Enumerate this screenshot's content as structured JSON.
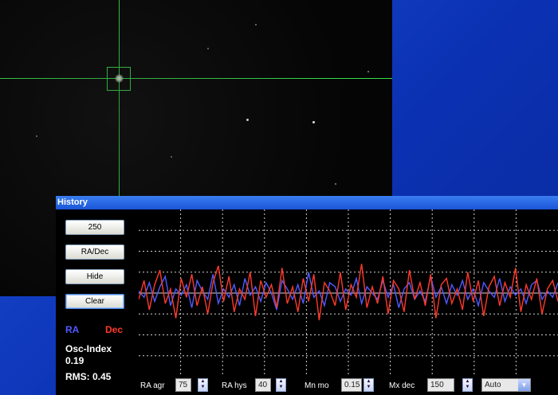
{
  "history_window": {
    "title": "History",
    "buttons": {
      "scale": "250",
      "mode": "RA/Dec",
      "hide": "Hide",
      "clear": "Clear"
    },
    "legend": {
      "ra": "RA",
      "dec": "Dec",
      "ra_color": "#4f5bff",
      "dec_color": "#ff3a2a"
    },
    "osc_index_label": "Osc-Index",
    "osc_index_value": "0.19",
    "rms_text": "RMS: 0.45"
  },
  "controls": {
    "ra_agr": {
      "label": "RA agr",
      "value": "75"
    },
    "ra_hys": {
      "label": "RA hys",
      "value": "40"
    },
    "mn_mo": {
      "label": "Mn mo",
      "value": "0.15"
    },
    "mx_dec": {
      "label": "Mx dec",
      "value": "150"
    },
    "dec_mode": {
      "label": "Auto"
    }
  },
  "chart_data": {
    "type": "line",
    "series": [
      {
        "name": "RA",
        "color": "#4f5bff",
        "values": [
          0.1,
          -0.2,
          0.5,
          -0.4,
          0.3,
          0.8,
          -0.6,
          0.2,
          -0.1,
          0.4,
          -0.7,
          0.6,
          0.1,
          -0.3,
          0.9,
          -0.5,
          0.2,
          -0.2,
          0.4,
          -0.6,
          0.7,
          -0.1,
          0.3,
          -0.4,
          0.5,
          0.0,
          -0.8,
          0.6,
          0.2,
          -0.3,
          0.4,
          -0.5,
          1.0,
          -0.2,
          0.1,
          -0.6,
          0.5,
          0.3,
          -0.4,
          0.2,
          -0.1,
          0.7,
          -0.5,
          0.3,
          0.0,
          -0.3,
          0.6,
          -0.2,
          0.4,
          -0.7,
          0.2,
          0.5,
          -0.3,
          0.1,
          -0.4,
          0.8,
          -0.2,
          0.3,
          -0.5,
          0.4,
          -0.1,
          0.6,
          -0.3,
          0.2,
          -0.6,
          0.5,
          0.1,
          -0.2,
          0.7,
          -0.4,
          0.3,
          -0.1,
          0.2,
          -0.5,
          0.4,
          0.6,
          -0.3,
          0.1,
          -0.2,
          0.5
        ]
      },
      {
        "name": "Dec",
        "color": "#ff3a2a",
        "values": [
          -0.3,
          0.6,
          -0.8,
          0.4,
          1.1,
          -0.5,
          0.2,
          -1.2,
          0.7,
          -0.2,
          0.9,
          -0.6,
          0.3,
          -1.0,
          0.5,
          1.3,
          -0.4,
          0.8,
          -0.9,
          0.2,
          -0.3,
          1.0,
          -1.1,
          0.6,
          -0.2,
          0.4,
          -0.7,
          1.2,
          -0.5,
          0.3,
          -0.9,
          0.7,
          -0.4,
          0.9,
          -1.3,
          0.5,
          0.1,
          -0.6,
          1.0,
          -0.8,
          0.4,
          -0.2,
          1.4,
          -0.7,
          0.3,
          -0.5,
          0.8,
          -1.0,
          0.6,
          0.2,
          -0.9,
          1.1,
          -0.3,
          0.5,
          -0.6,
          0.9,
          -1.2,
          0.4,
          0.7,
          -0.5,
          0.2,
          -0.8,
          1.0,
          -0.4,
          0.6,
          -1.1,
          0.3,
          0.8,
          -0.6,
          0.5,
          -0.2,
          1.2,
          -0.9,
          0.4,
          -0.3,
          0.7,
          -1.0,
          0.2,
          0.6,
          -0.4
        ]
      }
    ],
    "ylim": [
      -4,
      4
    ],
    "grid": true
  }
}
